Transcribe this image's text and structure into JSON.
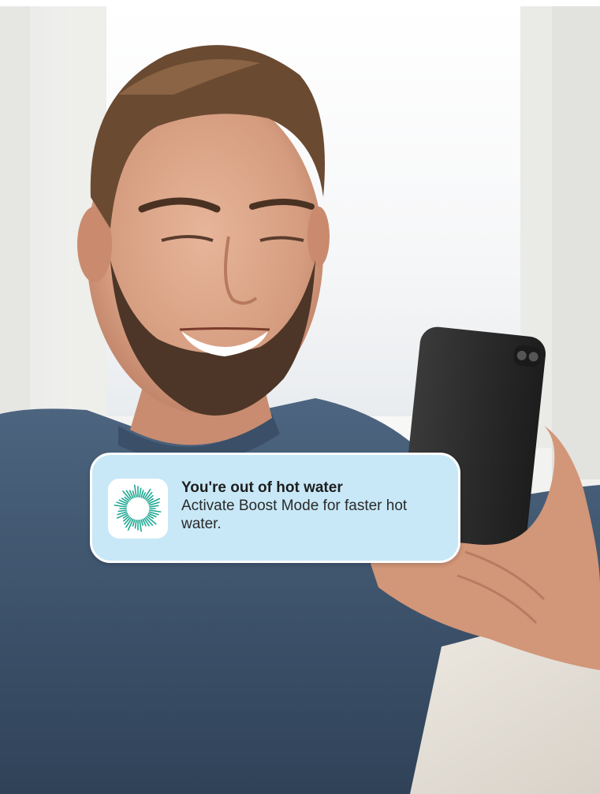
{
  "notification": {
    "title": "You're out of hot water",
    "body": "Activate Boost Mode for faster hot water.",
    "app_icon": "sunburst-icon",
    "accent_color": "#1fa892",
    "background_color": "#c8e8f7"
  },
  "photo": {
    "subject": "smiling-man-holding-phone-image"
  }
}
